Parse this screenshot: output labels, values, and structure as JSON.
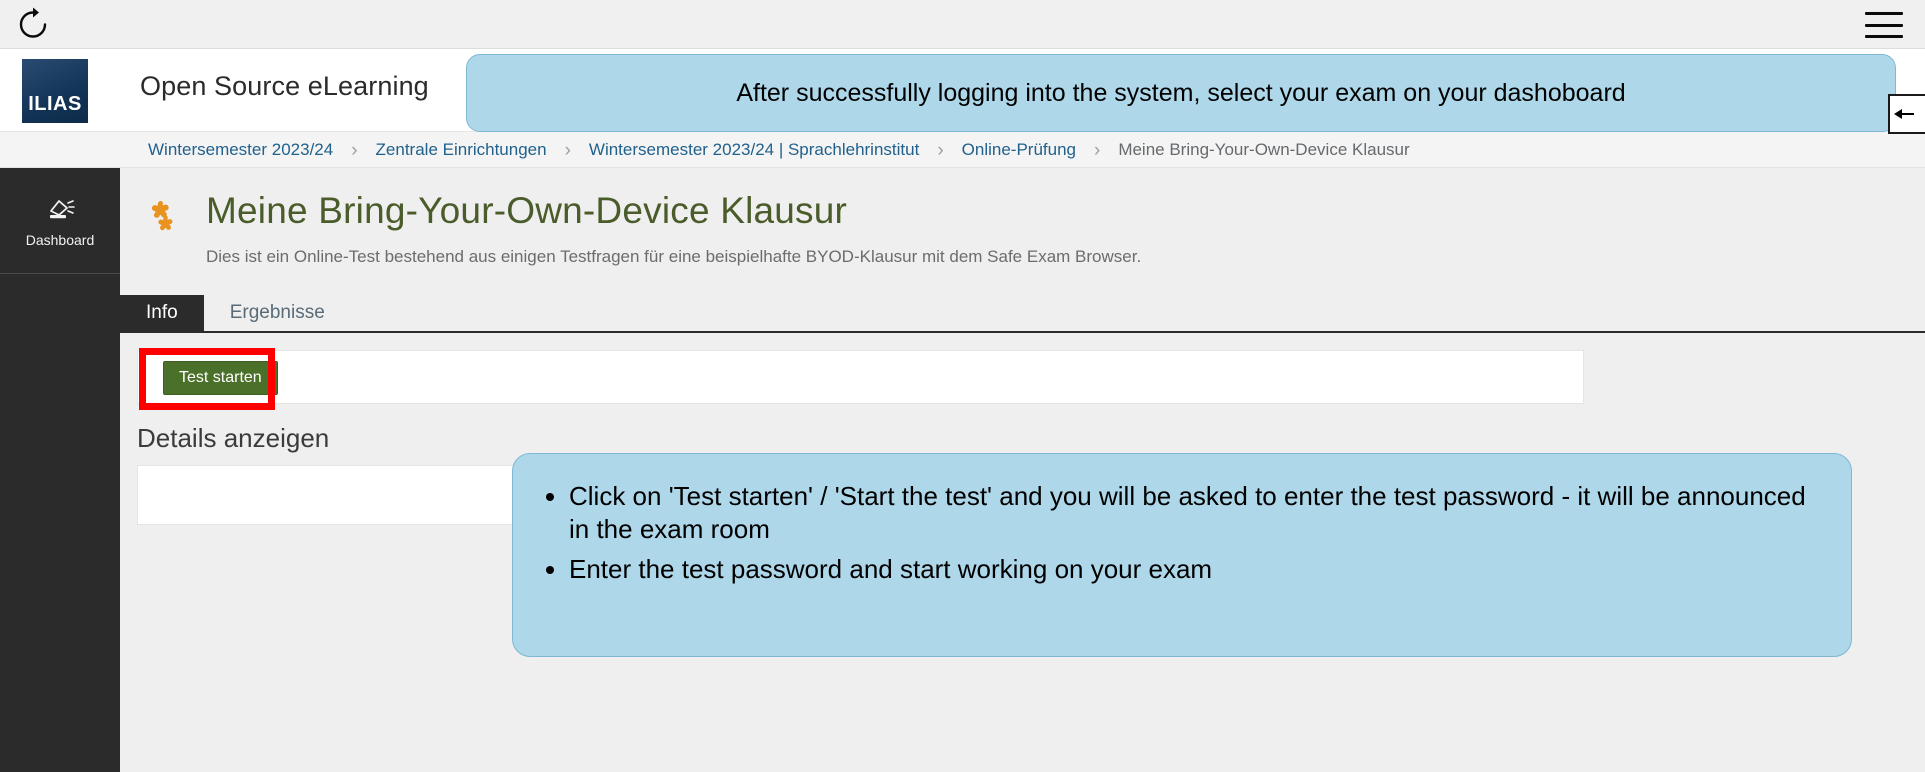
{
  "browser": {
    "reload_icon": "reload-icon",
    "menu_icon": "hamburger-menu-icon"
  },
  "header": {
    "logo_text": "ILIAS",
    "title": "Open Source eLearning"
  },
  "breadcrumb": {
    "separator": "›",
    "items": [
      {
        "label": "Wintersemester 2023/24",
        "current": false
      },
      {
        "label": "Zentrale Einrichtungen",
        "current": false
      },
      {
        "label": "Wintersemester 2023/24 | Sprachlehrinstitut",
        "current": false
      },
      {
        "label": "Online-Prüfung",
        "current": false
      },
      {
        "label": "Meine Bring-Your-Own-Device Klausur",
        "current": true
      }
    ]
  },
  "sidebar": {
    "items": [
      {
        "label": "Dashboard",
        "icon": "desk-lamp-icon"
      }
    ]
  },
  "main": {
    "icon": "puzzle-piece-icon",
    "title": "Meine Bring-Your-Own-Device Klausur",
    "subtitle": "Dies ist ein Online-Test bestehend aus einigen Testfragen für eine beispielhafte BYOD-Klausur mit dem Safe Exam Browser.",
    "tabs": [
      {
        "label": "Info",
        "active": true
      },
      {
        "label": "Ergebnisse",
        "active": false
      }
    ],
    "start_test_label": "Test starten",
    "details_heading": "Details anzeigen"
  },
  "annotations": {
    "top_callout": "After successfully logging into the system, select your exam on your dashoboard",
    "bottom_callout_items": [
      "Click on 'Test starten' / 'Start the test' and you will be asked to enter the test password - it will be announced in the exam room",
      "Enter the test password and start working on your exam"
    ]
  },
  "colors": {
    "callout_fill": "#aed8ea",
    "callout_border": "#7eb8d4",
    "highlight_red": "#ff0000",
    "button_green": "#4a7029",
    "title_green": "#4a5c2a",
    "puzzle_orange": "#e8921f",
    "logo_navy": "#123457",
    "rail_dark": "#2b2b2b",
    "link_blue": "#21618c"
  }
}
